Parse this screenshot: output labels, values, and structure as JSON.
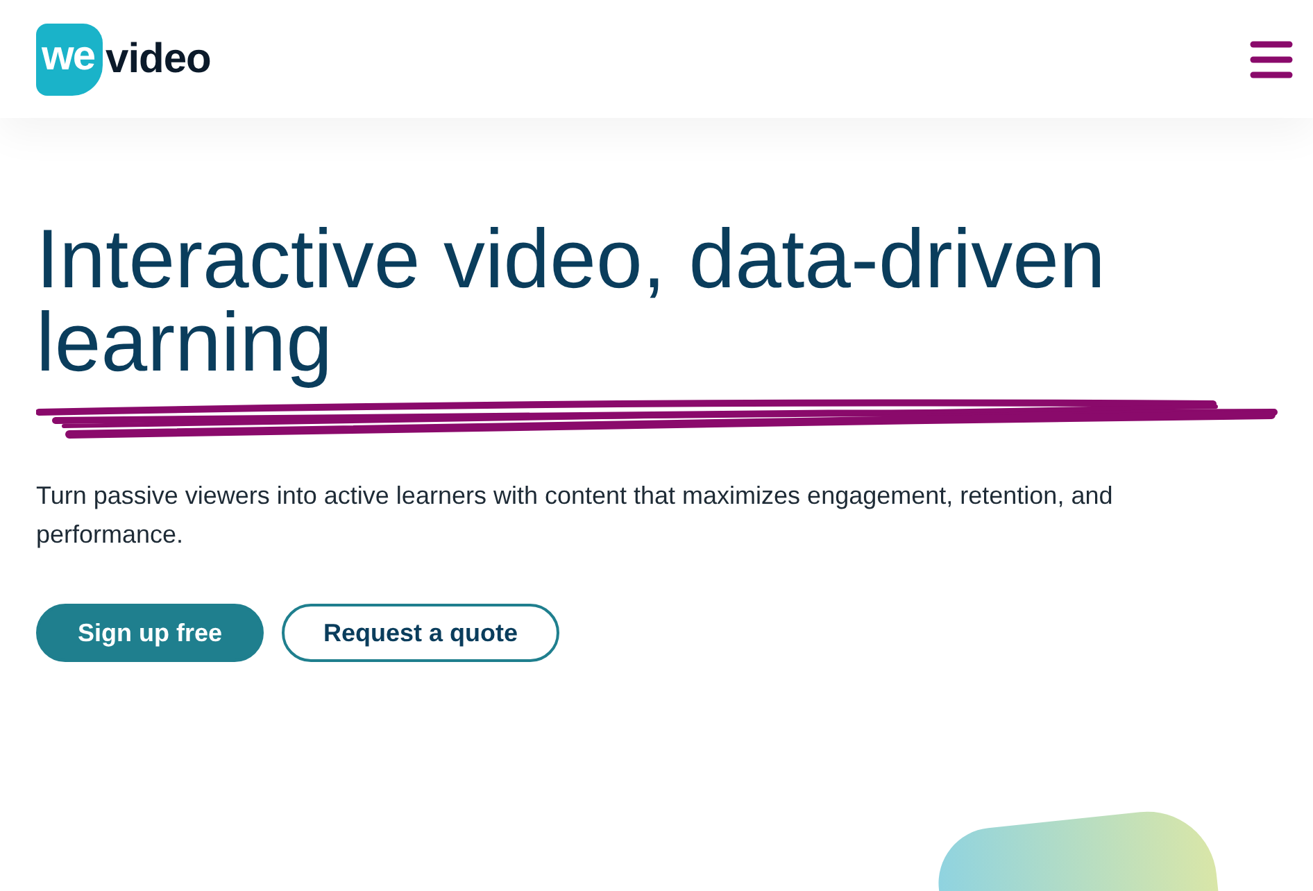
{
  "header": {
    "logo": {
      "mark": "we",
      "word": "video"
    }
  },
  "hero": {
    "title": "Interactive video, data-driven learning",
    "subtitle": "Turn passive viewers into active learners with content that maximizes engagement, retention, and performance.",
    "buttons": [
      {
        "label": "Sign up free",
        "kind": "primary"
      },
      {
        "label": "Request a quote",
        "kind": "outline"
      }
    ]
  }
}
